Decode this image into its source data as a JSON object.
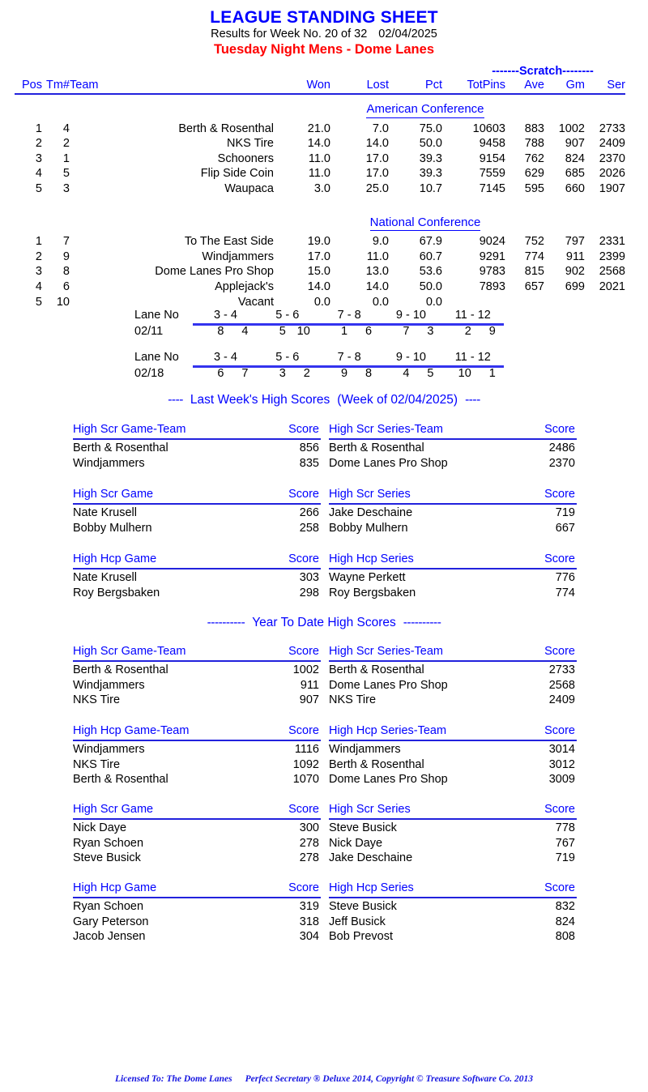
{
  "header": {
    "title": "LEAGUE STANDING SHEET",
    "subtitle_left": "Results for Week No. 20 of 32",
    "subtitle_date": "02/04/2025",
    "league_line": "Tuesday Night Mens - Dome Lanes",
    "title_color": "#0000FF",
    "league_color": "#FF0000"
  },
  "standings": {
    "group_label": "-------Scratch--------",
    "columns": {
      "pos": "Pos",
      "tm": "Tm#",
      "team": "Team",
      "won": "Won",
      "lost": "Lost",
      "pct": "Pct",
      "totpins": "TotPins",
      "ave": "Ave",
      "gm": "Gm",
      "ser": "Ser"
    },
    "conferences": [
      {
        "name": "American Conference",
        "rows": [
          {
            "pos": "1",
            "tm": "4",
            "team": "Berth & Rosenthal",
            "won": "21.0",
            "lost": "7.0",
            "pct": "75.0",
            "totpins": "10603",
            "ave": "883",
            "gm": "1002",
            "ser": "2733"
          },
          {
            "pos": "2",
            "tm": "2",
            "team": "NKS Tire",
            "won": "14.0",
            "lost": "14.0",
            "pct": "50.0",
            "totpins": "9458",
            "ave": "788",
            "gm": "907",
            "ser": "2409"
          },
          {
            "pos": "3",
            "tm": "1",
            "team": "Schooners",
            "won": "11.0",
            "lost": "17.0",
            "pct": "39.3",
            "totpins": "9154",
            "ave": "762",
            "gm": "824",
            "ser": "2370"
          },
          {
            "pos": "4",
            "tm": "5",
            "team": "Flip Side Coin",
            "won": "11.0",
            "lost": "17.0",
            "pct": "39.3",
            "totpins": "7559",
            "ave": "629",
            "gm": "685",
            "ser": "2026"
          },
          {
            "pos": "5",
            "tm": "3",
            "team": "Waupaca",
            "won": "3.0",
            "lost": "25.0",
            "pct": "10.7",
            "totpins": "7145",
            "ave": "595",
            "gm": "660",
            "ser": "1907"
          }
        ]
      },
      {
        "name": "National Conference",
        "rows": [
          {
            "pos": "1",
            "tm": "7",
            "team": "To The East Side",
            "won": "19.0",
            "lost": "9.0",
            "pct": "67.9",
            "totpins": "9024",
            "ave": "752",
            "gm": "797",
            "ser": "2331"
          },
          {
            "pos": "2",
            "tm": "9",
            "team": "Windjammers",
            "won": "17.0",
            "lost": "11.0",
            "pct": "60.7",
            "totpins": "9291",
            "ave": "774",
            "gm": "911",
            "ser": "2399"
          },
          {
            "pos": "3",
            "tm": "8",
            "team": "Dome Lanes Pro Shop",
            "won": "15.0",
            "lost": "13.0",
            "pct": "53.6",
            "totpins": "9783",
            "ave": "815",
            "gm": "902",
            "ser": "2568"
          },
          {
            "pos": "4",
            "tm": "6",
            "team": "Applejack's",
            "won": "14.0",
            "lost": "14.0",
            "pct": "50.0",
            "totpins": "7893",
            "ave": "657",
            "gm": "699",
            "ser": "2021"
          },
          {
            "pos": "5",
            "tm": "10",
            "team": "Vacant",
            "won": "0.0",
            "lost": "0.0",
            "pct": "0.0",
            "totpins": "",
            "ave": "",
            "gm": "",
            "ser": ""
          }
        ]
      }
    ]
  },
  "lane_schedules": [
    {
      "label": "Lane No",
      "date": "02/11",
      "lane_pairs": [
        "3 - 4",
        "5 - 6",
        "7 - 8",
        "9 - 10",
        "11 - 12"
      ],
      "matchups": [
        [
          "8",
          "4"
        ],
        [
          "5",
          "10"
        ],
        [
          "1",
          "6"
        ],
        [
          "7",
          "3"
        ],
        [
          "2",
          "9"
        ]
      ]
    },
    {
      "label": "Lane No",
      "date": "02/18",
      "lane_pairs": [
        "3 - 4",
        "5 - 6",
        "7 - 8",
        "9 - 10",
        "11 - 12"
      ],
      "matchups": [
        [
          "6",
          "7"
        ],
        [
          "3",
          "2"
        ],
        [
          "9",
          "8"
        ],
        [
          "4",
          "5"
        ],
        [
          "10",
          "1"
        ]
      ]
    }
  ],
  "last_week": {
    "heading_dash_left": "----",
    "heading_text": "Last Week's High Scores",
    "heading_paren": "(Week of 02/04/2025)",
    "heading_dash_right": "----",
    "blocks": [
      {
        "left": {
          "title": "High Scr Game-Team",
          "score_label": "Score",
          "rows": [
            {
              "name": "Berth & Rosenthal",
              "score": "856"
            },
            {
              "name": "Windjammers",
              "score": "835"
            }
          ]
        },
        "right": {
          "title": "High Scr Series-Team",
          "score_label": "Score",
          "rows": [
            {
              "name": "Berth & Rosenthal",
              "score": "2486"
            },
            {
              "name": "Dome Lanes Pro Shop",
              "score": "2370"
            }
          ]
        }
      },
      {
        "left": {
          "title": "High Scr Game",
          "score_label": "Score",
          "rows": [
            {
              "name": "Nate Krusell",
              "score": "266"
            },
            {
              "name": "Bobby Mulhern",
              "score": "258"
            }
          ]
        },
        "right": {
          "title": "High Scr Series",
          "score_label": "Score",
          "rows": [
            {
              "name": "Jake Deschaine",
              "score": "719"
            },
            {
              "name": "Bobby Mulhern",
              "score": "667"
            }
          ]
        }
      },
      {
        "left": {
          "title": "High Hcp Game",
          "score_label": "Score",
          "rows": [
            {
              "name": "Nate Krusell",
              "score": "303"
            },
            {
              "name": "Roy Bergsbaken",
              "score": "298"
            }
          ]
        },
        "right": {
          "title": "High Hcp Series",
          "score_label": "Score",
          "rows": [
            {
              "name": "Wayne Perkett",
              "score": "776"
            },
            {
              "name": "Roy Bergsbaken",
              "score": "774"
            }
          ]
        }
      }
    ]
  },
  "year_to_date": {
    "heading_dash_left": "----------",
    "heading_text": "Year To Date High Scores",
    "heading_dash_right": "----------",
    "blocks": [
      {
        "left": {
          "title": "High Scr Game-Team",
          "score_label": "Score",
          "rows": [
            {
              "name": "Berth & Rosenthal",
              "score": "1002"
            },
            {
              "name": "Windjammers",
              "score": "911"
            },
            {
              "name": "NKS Tire",
              "score": "907"
            }
          ]
        },
        "right": {
          "title": "High Scr Series-Team",
          "score_label": "Score",
          "rows": [
            {
              "name": "Berth & Rosenthal",
              "score": "2733"
            },
            {
              "name": "Dome Lanes Pro Shop",
              "score": "2568"
            },
            {
              "name": "NKS Tire",
              "score": "2409"
            }
          ]
        }
      },
      {
        "left": {
          "title": "High Hcp Game-Team",
          "score_label": "Score",
          "rows": [
            {
              "name": "Windjammers",
              "score": "1116"
            },
            {
              "name": "NKS Tire",
              "score": "1092"
            },
            {
              "name": "Berth & Rosenthal",
              "score": "1070"
            }
          ]
        },
        "right": {
          "title": "High Hcp Series-Team",
          "score_label": "Score",
          "rows": [
            {
              "name": "Windjammers",
              "score": "3014"
            },
            {
              "name": "Berth & Rosenthal",
              "score": "3012"
            },
            {
              "name": "Dome Lanes Pro Shop",
              "score": "3009"
            }
          ]
        }
      },
      {
        "left": {
          "title": "High Scr Game",
          "score_label": "Score",
          "rows": [
            {
              "name": "Nick Daye",
              "score": "300"
            },
            {
              "name": "Ryan Schoen",
              "score": "278"
            },
            {
              "name": "Steve Busick",
              "score": "278"
            }
          ]
        },
        "right": {
          "title": "High Scr Series",
          "score_label": "Score",
          "rows": [
            {
              "name": "Steve Busick",
              "score": "778"
            },
            {
              "name": "Nick Daye",
              "score": "767"
            },
            {
              "name": "Jake Deschaine",
              "score": "719"
            }
          ]
        }
      },
      {
        "left": {
          "title": "High Hcp Game",
          "score_label": "Score",
          "rows": [
            {
              "name": "Ryan Schoen",
              "score": "319"
            },
            {
              "name": "Gary Peterson",
              "score": "318"
            },
            {
              "name": "Jacob Jensen",
              "score": "304"
            }
          ]
        },
        "right": {
          "title": "High Hcp Series",
          "score_label": "Score",
          "rows": [
            {
              "name": "Steve Busick",
              "score": "832"
            },
            {
              "name": "Jeff Busick",
              "score": "824"
            },
            {
              "name": "Bob Prevost",
              "score": "808"
            }
          ]
        }
      }
    ]
  },
  "footer": {
    "licensed_to": "Licensed To: The Dome Lanes",
    "product": "Perfect Secretary ® Deluxe  2014, Copyright © Treasure Software Co. 2013"
  }
}
